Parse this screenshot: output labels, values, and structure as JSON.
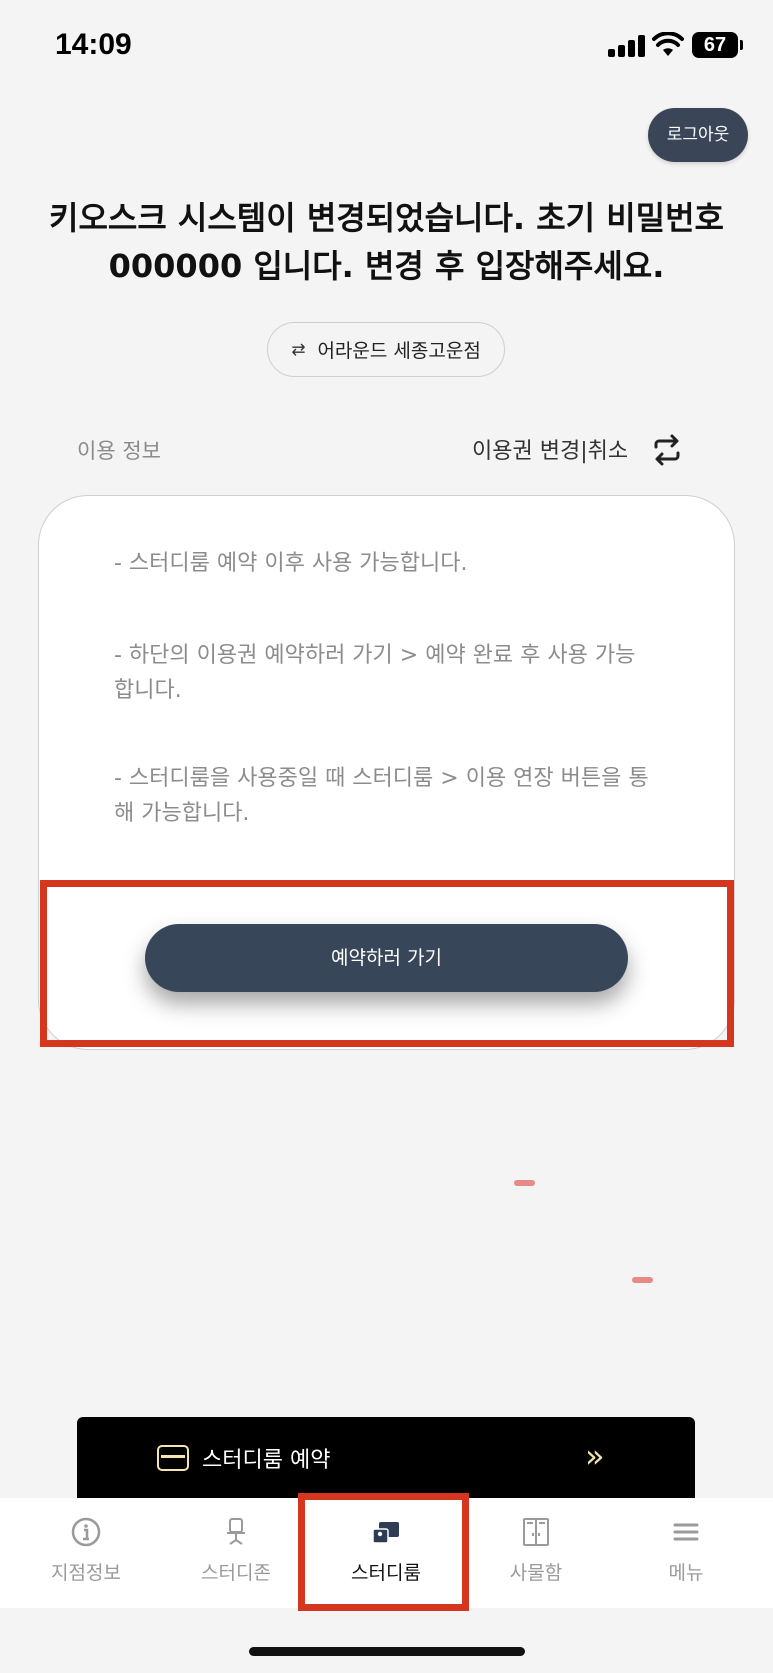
{
  "status_bar": {
    "time": "14:09",
    "battery": "67"
  },
  "header": {
    "logout_label": "로그아웃"
  },
  "notice": {
    "message": "키오스크 시스템이 변경되었습니다. 초기 비밀번호 000000 입니다. 변경 후 입장해주세요."
  },
  "branch": {
    "name": "어라운드 세종고운점",
    "icon": "swap-icon"
  },
  "usage": {
    "section_label": "이용 정보",
    "change_label": "이용권 변경|취소",
    "change_icon": "refresh-icon",
    "info_lines": [
      "- 스터디룸 예약 이후 사용 가능합니다.",
      "- 하단의 이용권 예약하러 가기 > 예약 완료 후 사용 가능합니다.",
      "- 스터디룸을 사용중일 때 스터디룸 > 이용 연장 버튼을 통해 가능합니다."
    ],
    "reserve_button": "예약하러 가기"
  },
  "promo": {
    "label": "스터디룸 예약",
    "icon": "card-icon",
    "chevron": "»"
  },
  "tabs": [
    {
      "label": "지점정보",
      "icon": "info-icon",
      "active": false
    },
    {
      "label": "스터디존",
      "icon": "seat-icon",
      "active": false
    },
    {
      "label": "스터디룸",
      "icon": "room-icon",
      "active": true
    },
    {
      "label": "사물함",
      "icon": "locker-icon",
      "active": false
    },
    {
      "label": "메뉴",
      "icon": "menu-icon",
      "active": false
    }
  ],
  "colors": {
    "primary": "#38465a",
    "highlight": "#d4361e",
    "promo_accent": "#f3e4b0",
    "background": "#f4f4f4"
  }
}
